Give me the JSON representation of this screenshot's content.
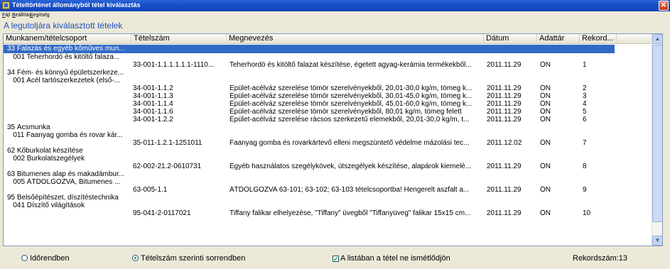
{
  "window": {
    "title": "Tételtörténet állományból tétel kiválasztás",
    "close_glyph": "✕"
  },
  "menu": [
    "Fájl",
    "Beállítás",
    "Segítség"
  ],
  "section_title": "A legutoljára kiválasztott tételek",
  "columns": [
    "Munkanem/tételcsoport",
    "Tételszám",
    "Megnevezés",
    "Dátum",
    "Adattár",
    "Rekord..."
  ],
  "rows": [
    {
      "group": "33 Falazás és egyéb kőműves mun...",
      "code": "",
      "name": "",
      "date": "",
      "store": "",
      "rec": "",
      "selected": true
    },
    {
      "group": "   001 Teherhordó és kitöltő falaza...",
      "code": "",
      "name": "",
      "date": "",
      "store": "",
      "rec": ""
    },
    {
      "group": "",
      "code": "33-001-1.1.1.1.1.1-1110...",
      "name": "Teherhordó és kitöltő falazat készítése, égetett agyag-kerámia termékekből...",
      "date": "2011.11.29",
      "store": "ÖN",
      "rec": "1"
    },
    {
      "group": "34 Fém- és könnyű épületszerkeze...",
      "code": "",
      "name": "",
      "date": "",
      "store": "",
      "rec": ""
    },
    {
      "group": "   001 Acél tartószerkezetek (első-...",
      "code": "",
      "name": "",
      "date": "",
      "store": "",
      "rec": ""
    },
    {
      "group": "",
      "code": "34-001-1.1.2",
      "name": "Épület-acélváz szerelése tömör szerelvényekből, 20,01-30,0 kg/m, tömeg k...",
      "date": "2011.11.29",
      "store": "ÖN",
      "rec": "2"
    },
    {
      "group": "",
      "code": "34-001-1.1.3",
      "name": "Épület-acélváz szerelése tömör szerelvényekből, 30,01-45,0 kg/m, tömeg k...",
      "date": "2011.11.29",
      "store": "ÖN",
      "rec": "3"
    },
    {
      "group": "",
      "code": "34-001-1.1.4",
      "name": "Épület-acélváz szerelése tömör szerelvényekből, 45,01-60,0 kg/m, tömeg k...",
      "date": "2011.11.29",
      "store": "ÖN",
      "rec": "4"
    },
    {
      "group": "",
      "code": "34-001-1.1.6",
      "name": "Épület-acélváz szerelése tömör szerelvényekből, 80,01 kg/m, tömeg felett",
      "date": "2011.11.29",
      "store": "ÖN",
      "rec": "5"
    },
    {
      "group": "",
      "code": "34-001-1.2.2",
      "name": "Épület-acélváz szerelése rácsos szerkezetű elemekből, 20,01-30,0 kg/m, t...",
      "date": "2011.11.29",
      "store": "ÖN",
      "rec": "6"
    },
    {
      "group": "35 Ácsmunka",
      "code": "",
      "name": "",
      "date": "",
      "store": "",
      "rec": ""
    },
    {
      "group": "   011 Faanyag gomba és rovar kár...",
      "code": "",
      "name": "",
      "date": "",
      "store": "",
      "rec": ""
    },
    {
      "group": "",
      "code": "35-011-1.2.1-1251011",
      "name": "Faanyag gomba és rovarkártevő elleni megszüntető védelme mázolási tec...",
      "date": "2011.12.02",
      "store": "ÖN",
      "rec": "7"
    },
    {
      "group": "62 Kőburkolat készítése",
      "code": "",
      "name": "",
      "date": "",
      "store": "",
      "rec": ""
    },
    {
      "group": "   002 Burkolatszegélyek",
      "code": "",
      "name": "",
      "date": "",
      "store": "",
      "rec": ""
    },
    {
      "group": "",
      "code": "62-002-21.2-0610731",
      "name": "Egyéb használatos szegélykövek, útszegélyek készítése, alapárok kiemelé...",
      "date": "2011.11.29",
      "store": "ÖN",
      "rec": "8"
    },
    {
      "group": "63 Bitumenes alap és makadámbur...",
      "code": "",
      "name": "",
      "date": "",
      "store": "",
      "rec": ""
    },
    {
      "group": "   005 ÁTDOLGOZVA, Bitumenes ...",
      "code": "",
      "name": "",
      "date": "",
      "store": "",
      "rec": ""
    },
    {
      "group": "",
      "code": "63-005-1.1",
      "name": "ÁTDOLGOZVA 63-101; 63-102; 63-103 tételcsoportba! Hengerelt aszfalt a...",
      "date": "2011.11.29",
      "store": "ÖN",
      "rec": "9"
    },
    {
      "group": "95 Belsőépítészet, díszítéstechnika",
      "code": "",
      "name": "",
      "date": "",
      "store": "",
      "rec": ""
    },
    {
      "group": "   041 Díszítő világítások",
      "code": "",
      "name": "",
      "date": "",
      "store": "",
      "rec": ""
    },
    {
      "group": "",
      "code": "95-041-2-0117021",
      "name": "Tiffany falikar elhelyezése, \"Tiffany\" üvegből \"Tiffanyüveg\" falikar 15x15 cm...",
      "date": "2011.11.29",
      "store": "ÖN",
      "rec": "10"
    }
  ],
  "footer": {
    "opt_time": "Időrendben",
    "opt_code": "Tételszám szerinti sorrendben",
    "opt_norepeat": "A listában a tétel ne ismétlődjön",
    "count": "Rekordszám:13"
  },
  "scroll_up": "▲",
  "scroll_down": "▼"
}
